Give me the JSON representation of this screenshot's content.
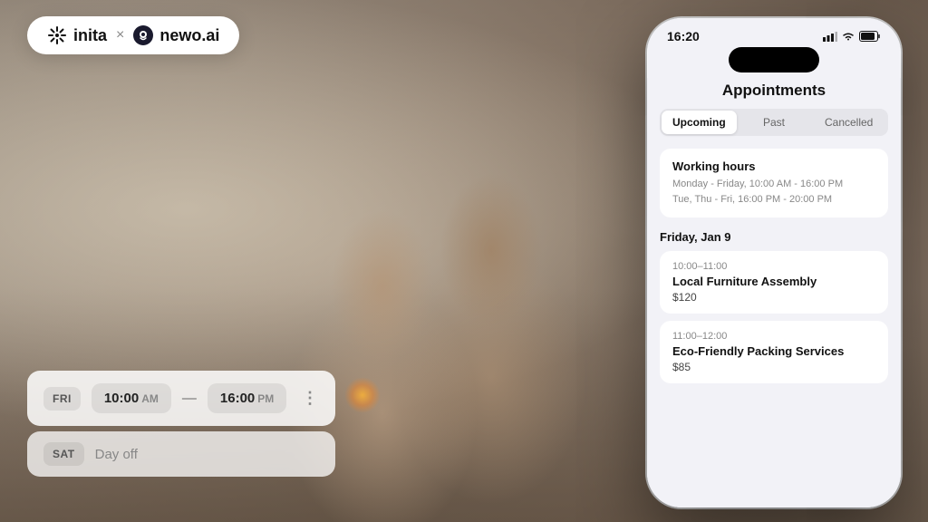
{
  "logo": {
    "brand1": "inita",
    "separator": "×",
    "brand2": "newo.ai"
  },
  "scheduler": {
    "row1": {
      "day": "FRI",
      "start_time": "10:00",
      "start_period": "AM",
      "separator": "—",
      "end_time": "16:00",
      "end_period": "PM",
      "more": "⋮"
    },
    "row2": {
      "day": "SAT",
      "status": "Day off"
    }
  },
  "phone": {
    "status_time": "16:20",
    "signal": "▂▄▆",
    "wifi": "wifi",
    "battery": "battery",
    "title": "Appointments",
    "tabs": [
      {
        "label": "Upcoming",
        "active": true
      },
      {
        "label": "Past",
        "active": false
      },
      {
        "label": "Cancelled",
        "active": false
      }
    ],
    "working_hours": {
      "title": "Working hours",
      "line1": "Monday - Friday, 10:00 AM - 16:00 PM",
      "line2": "Tue, Thu - Fri, 16:00 PM - 20:00 PM"
    },
    "date_header": "Friday, Jan 9",
    "appointments": [
      {
        "time": "10:00–11:00",
        "name": "Local Furniture Assembly",
        "price": "$120"
      },
      {
        "time": "11:00–12:00",
        "name": "Eco-Friendly Packing Services",
        "price": "$85"
      }
    ]
  }
}
